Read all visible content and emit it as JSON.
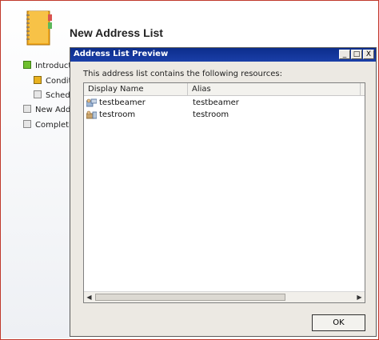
{
  "wizard": {
    "title": "New Address List",
    "steps": [
      {
        "label": "Introductio",
        "state": "green"
      },
      {
        "label": "Conditi",
        "state": "gold"
      },
      {
        "label": "Sched",
        "state": "gray"
      },
      {
        "label": "New Addr",
        "state": "gray"
      },
      {
        "label": "Completion",
        "state": "gray"
      }
    ]
  },
  "dialog": {
    "title": "Address List Preview",
    "buttons": {
      "minimize": "_",
      "maximize": "□",
      "close": "X"
    },
    "intro_text": "This address list contains the following resources:",
    "columns": [
      "Display Name",
      "Alias"
    ],
    "rows": [
      {
        "display_name": "testbeamer",
        "alias": "testbeamer",
        "icon": "equipment-resource-icon"
      },
      {
        "display_name": "testroom",
        "alias": "testroom",
        "icon": "room-resource-icon"
      }
    ],
    "ok_label": "OK"
  },
  "colors": {
    "titlebar": "#0c2d8c",
    "dialog_bg": "#ece9e3",
    "frame": "#c0392b"
  }
}
